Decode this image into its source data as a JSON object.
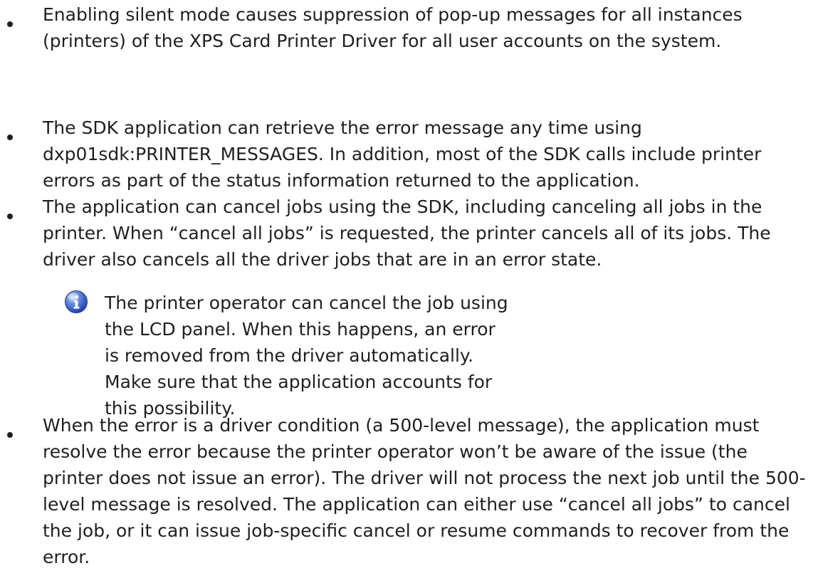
{
  "bullets": [
    {
      "text": "Enabling silent mode causes suppression of pop-up messages for all instances (printers) of the XPS Card Printer Driver for all user accounts on the system."
    },
    {
      "text": "The SDK application can retrieve the error message any time using dxp01sdk:PRINTER_MESSAGES. In addition, most of the SDK calls include printer errors as part of the status information returned to the application."
    },
    {
      "text": "The application can cancel jobs using the SDK, including canceling all jobs in the printer. When “cancel all jobs” is requested, the printer cancels all of its jobs. The driver also cancels all the driver jobs that are in an error state."
    },
    {
      "text": "When the error is a driver condition (a 500-level message), the application must resolve the error because the printer operator won’t be aware of the issue (the printer does not issue an error). The driver will not process the next job until the 500-level message is resolved. The application can either use “cancel all jobs” to cancel the job, or it can issue job-specific cancel or resume commands to recover from the error."
    }
  ],
  "note": {
    "icon": "info-icon",
    "text": "The printer operator can cancel the job using the LCD panel. When this happens, an error is removed from the driver automatically. Make sure that the application accounts for this possibility."
  },
  "colors": {
    "text": "#1f1f1f",
    "icon_blue": "#3a63c9"
  }
}
